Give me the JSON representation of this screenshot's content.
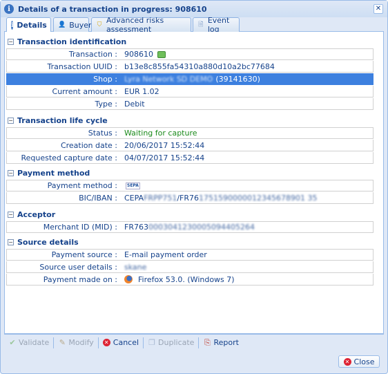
{
  "window": {
    "title": "Details of a transaction in progress: 908610"
  },
  "tabs": [
    {
      "label": "Details",
      "icon": "info-icon"
    },
    {
      "label": "Buyer",
      "icon": "user-icon"
    },
    {
      "label": "Advanced risks assessment",
      "icon": "shield-icon"
    },
    {
      "label": "Event log",
      "icon": "document-icon"
    }
  ],
  "sections": {
    "identification": {
      "title": "Transaction identification",
      "rows": [
        {
          "label": "Transaction :",
          "value": "908610"
        },
        {
          "label": "Transaction UUID :",
          "value": "b13e8c855fa54310a880d10a2bc77684"
        },
        {
          "label": "Shop :",
          "value": "Lyra Network SD DEMO",
          "value_extra": "(39141630)"
        },
        {
          "label": "Current amount :",
          "value": "EUR 1.02"
        },
        {
          "label": "Type :",
          "value": "Debit"
        }
      ]
    },
    "lifecycle": {
      "title": "Transaction life cycle",
      "rows": [
        {
          "label": "Status :",
          "value": "Waiting for capture"
        },
        {
          "label": "Creation date :",
          "value": "20/06/2017 15:52:44"
        },
        {
          "label": "Requested capture date :",
          "value": "04/07/2017 15:52:44"
        }
      ]
    },
    "payment": {
      "title": "Payment method",
      "rows": [
        {
          "label": "Payment method :",
          "value": "SEPA"
        },
        {
          "label": "BIC/IBAN :",
          "value_prefix": "CEPA",
          "value_blur1": "FRPP751",
          "value_mid": "/FR76",
          "value_blur2": "1751590000012345678901 35"
        }
      ]
    },
    "acceptor": {
      "title": "Acceptor",
      "rows": [
        {
          "label": "Merchant ID (MID) :",
          "value_prefix": "FR763",
          "value_blur": "0003041230005094405264"
        }
      ]
    },
    "source": {
      "title": "Source details",
      "rows": [
        {
          "label": "Payment source :",
          "value": "E-mail payment order"
        },
        {
          "label": "Source user details :",
          "value": "skane"
        },
        {
          "label": "Payment made on :",
          "value": "Firefox 53.0. (Windows 7)"
        }
      ]
    }
  },
  "toolbar": {
    "validate": "Validate",
    "modify": "Modify",
    "cancel": "Cancel",
    "duplicate": "Duplicate",
    "report": "Report"
  },
  "footer": {
    "close": "Close"
  },
  "colors": {
    "selected_row": "#3d80df",
    "status_green": "#1a8a1a",
    "window_bg": "#dfe8f6"
  }
}
